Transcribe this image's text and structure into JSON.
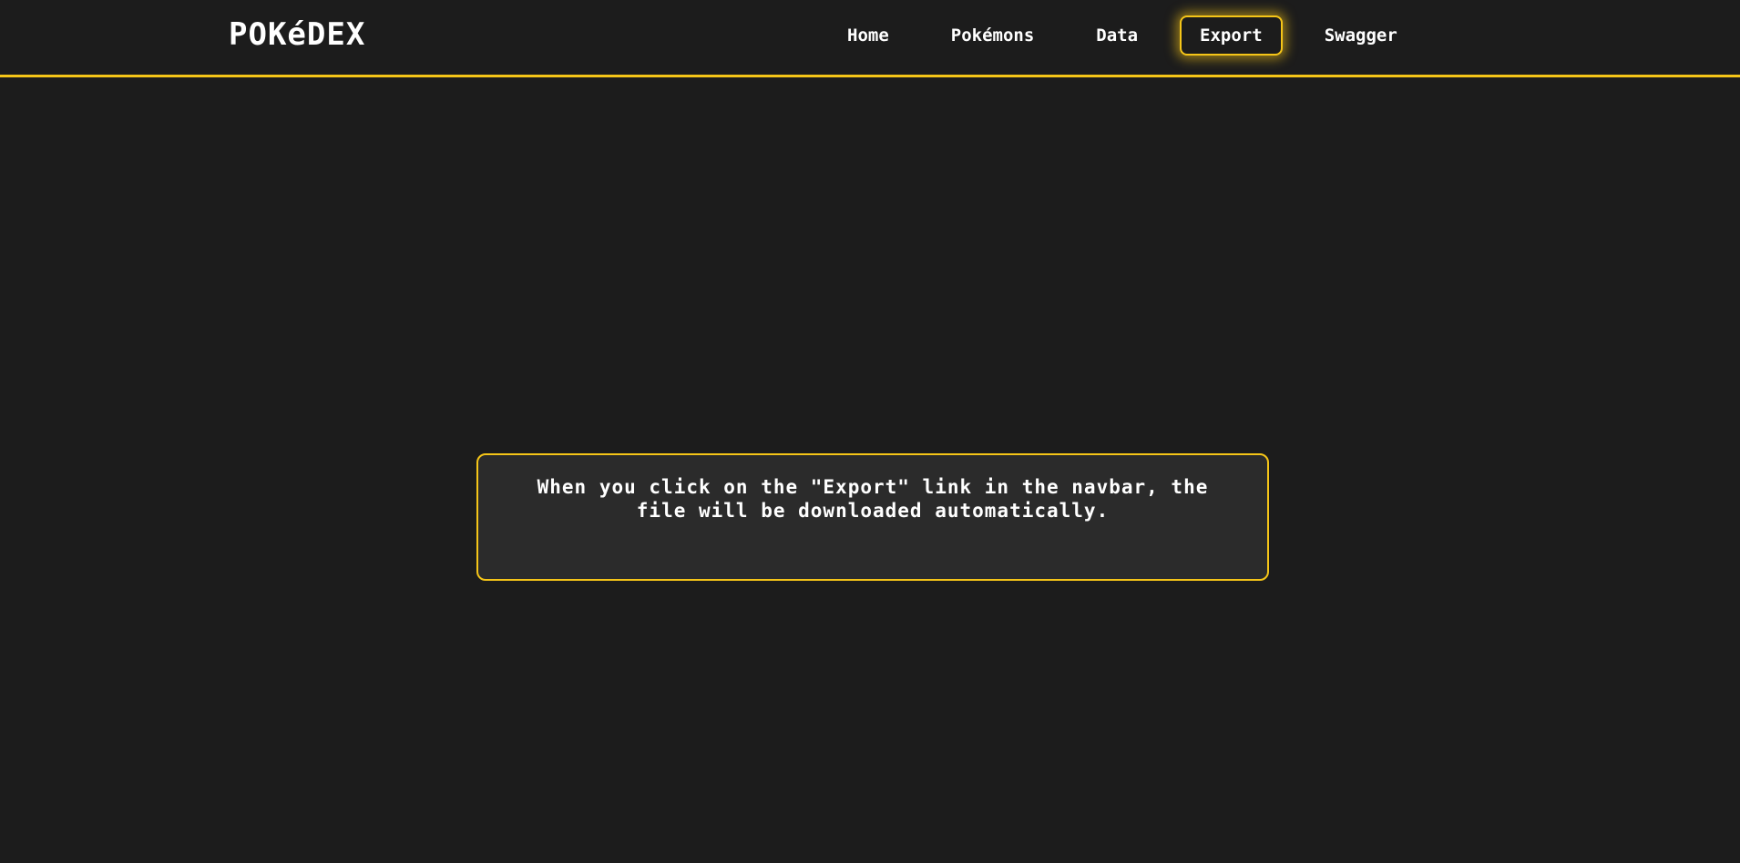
{
  "header": {
    "logo": "POKéDEX"
  },
  "nav": {
    "items": [
      {
        "label": "Home",
        "active": false
      },
      {
        "label": "Pokémons",
        "active": false
      },
      {
        "label": "Data",
        "active": false
      },
      {
        "label": "Export",
        "active": true
      },
      {
        "label": "Swagger",
        "active": false
      }
    ]
  },
  "main": {
    "message": "When you click on the \"Export\" link in the navbar, the file will be downloaded automatically."
  },
  "colors": {
    "background": "#1c1c1c",
    "accent": "#f5c518",
    "box_background": "#2b2b2b",
    "text": "#ffffff"
  }
}
